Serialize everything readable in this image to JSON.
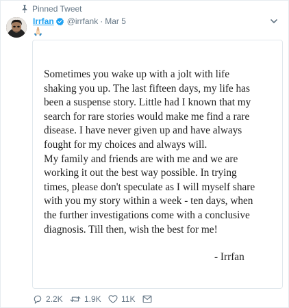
{
  "pinned": {
    "label": "Pinned Tweet",
    "icon": "pin-icon"
  },
  "author": {
    "display_name": "Irrfan",
    "verified": true,
    "handle": "@irrfank",
    "separator": "·",
    "timestamp": "Mar 5",
    "avatar_icon": "avatar"
  },
  "tweet": {
    "emoji": "🙏🏻"
  },
  "image": {
    "paragraph_1": "Sometimes you wake up with a jolt with life\nshaking you up. The last fifteen days, my life has\nbeen a suspense story. Little had I known that my\nsearch for rare stories would make me find a rare\ndisease. I have never given up and have always\nfought for my choices and always will.",
    "paragraph_2": "My family and friends are with me and we are\nworking it out the best way possible. In trying\ntimes, please don't speculate as I will myself share\nwith you my story within a week - ten days, when\nthe further investigations come with a conclusive\ndiagnosis. Till then, wish the best for me!",
    "signature": "- Irrfan"
  },
  "actions": {
    "replies": "2.2K",
    "retweets": "1.9K",
    "likes": "11K"
  },
  "colors": {
    "accent": "#1da1f2",
    "muted": "#657786",
    "border": "#e1e8ed"
  }
}
